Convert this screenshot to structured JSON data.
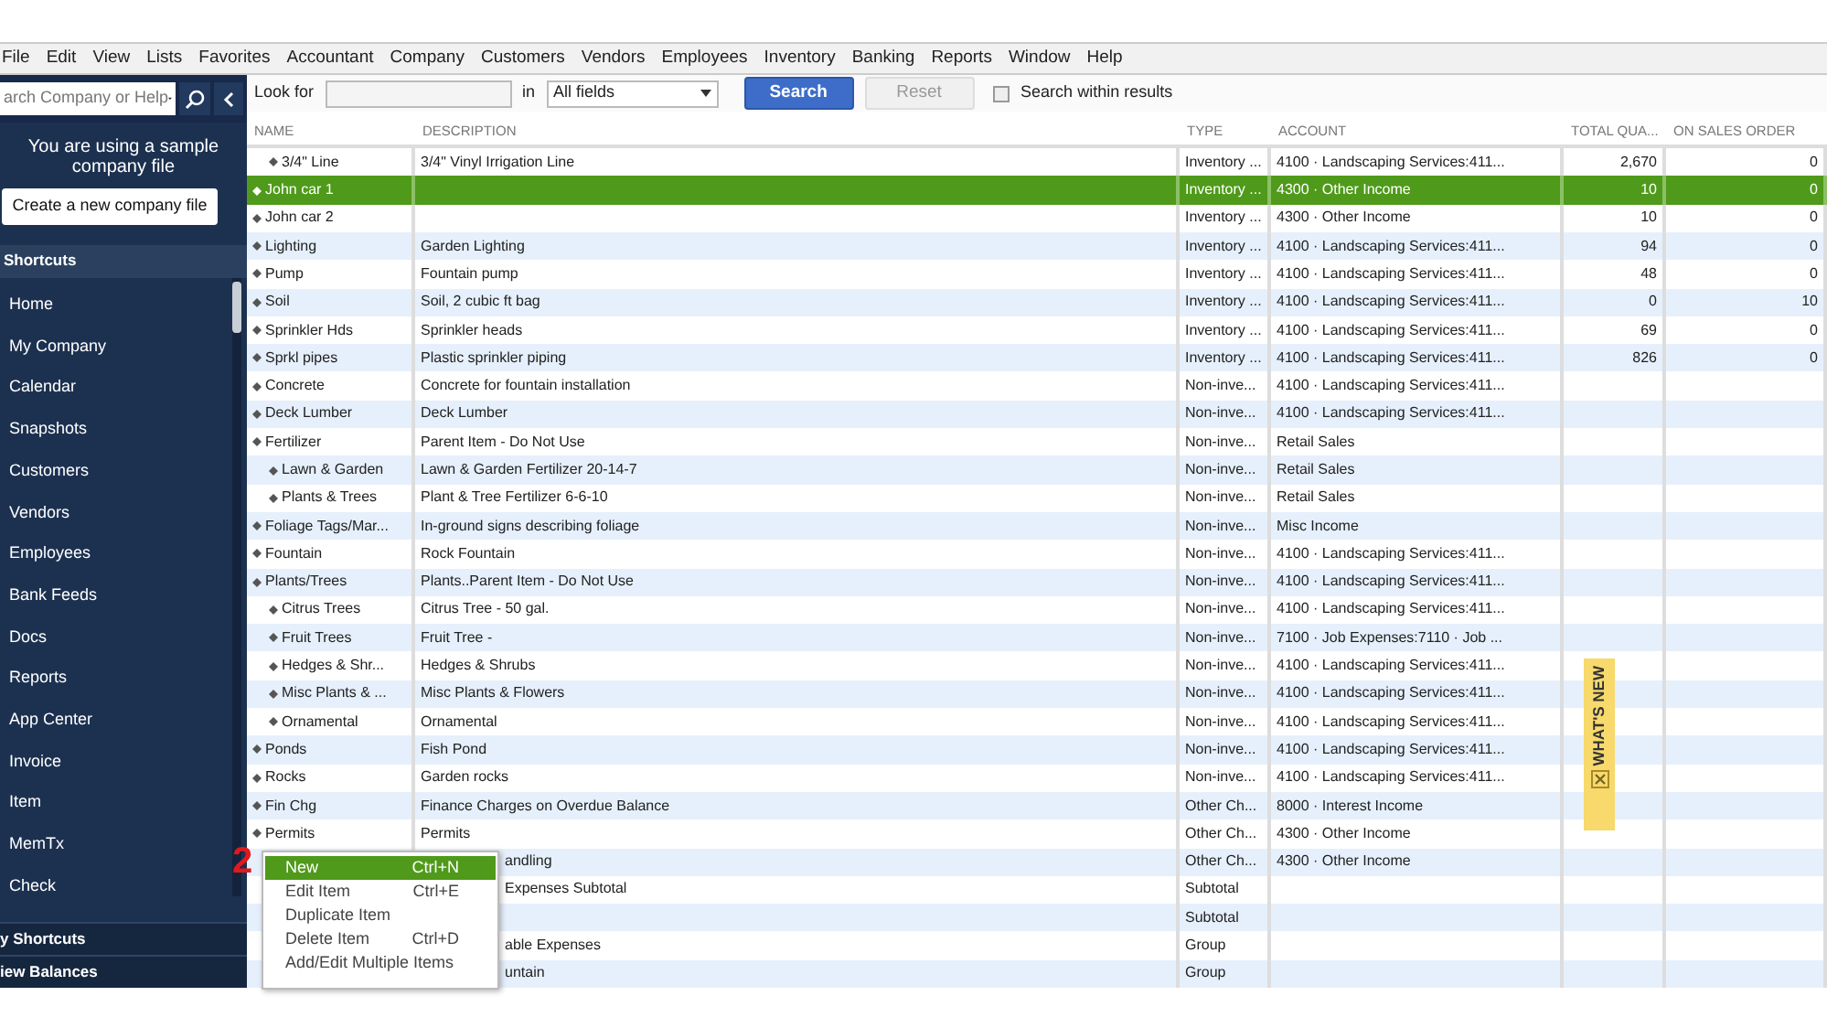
{
  "menu_bar": [
    "File",
    "Edit",
    "View",
    "Lists",
    "Favorites",
    "Accountant",
    "Company",
    "Customers",
    "Vendors",
    "Employees",
    "Inventory",
    "Banking",
    "Reports",
    "Window",
    "Help"
  ],
  "sidebar": {
    "search": {
      "placeholder": "arch Company or Help"
    },
    "sample_notice": "You are using a sample company file",
    "create_button": "Create a new company file",
    "header": "Shortcuts",
    "items": [
      "Home",
      "My Company",
      "Calendar",
      "Snapshots",
      "Customers",
      "Vendors",
      "Employees",
      "Bank Feeds",
      "Docs",
      "Reports",
      "App Center",
      "Invoice",
      "Item",
      "MemTx",
      "Check"
    ],
    "footer": [
      "y Shortcuts",
      "iew Balances"
    ]
  },
  "search_bar": {
    "look_for_label": "Look for",
    "in_label": "in",
    "field_select": "All fields",
    "search_button": "Search",
    "reset_button": "Reset",
    "reset_disabled": true,
    "within_results": {
      "label": "Search within results",
      "checked": false
    }
  },
  "table": {
    "columns": [
      "NAME",
      "DESCRIPTION",
      "TYPE",
      "ACCOUNT",
      "TOTAL QUA...",
      "ON SALES ORDER"
    ],
    "rows": [
      {
        "children": [
          {
            "name": "3/4\" Line",
            "description": "3/4\"  Vinyl Irrigation Line",
            "type": "Inventory ...",
            "account": "4100 · Landscaping Services:411...",
            "total_qty": "2,670",
            "on_sales_order": "0",
            "selected": false
          }
        ]
      },
      {
        "name": "John car 1",
        "type": "Inventory ...",
        "account": "4300 · Other Income",
        "total_qty": "10",
        "on_sales_order": "0",
        "selected": true
      },
      {
        "name": "John car 2",
        "type": "Inventory ...",
        "account": "4300 · Other Income",
        "total_qty": "10",
        "on_sales_order": "0",
        "selected": false
      },
      {
        "name": "Lighting",
        "description": "Garden Lighting",
        "type": "Inventory ...",
        "account": "4100 · Landscaping Services:411...",
        "total_qty": "94",
        "on_sales_order": "0",
        "selected": false
      },
      {
        "name": "Pump",
        "description": "Fountain pump",
        "type": "Inventory ...",
        "account": "4100 · Landscaping Services:411...",
        "total_qty": "48",
        "on_sales_order": "0",
        "selected": false
      },
      {
        "name": "Soil",
        "description": "Soil, 2 cubic ft bag",
        "type": "Inventory ...",
        "account": "4100 · Landscaping Services:411...",
        "total_qty": "0",
        "on_sales_order": "10",
        "selected": false
      },
      {
        "name": "Sprinkler Hds",
        "description": "Sprinkler heads",
        "type": "Inventory ...",
        "account": "4100 · Landscaping Services:411...",
        "total_qty": "69",
        "on_sales_order": "0",
        "selected": false
      },
      {
        "name": "Sprkl pipes",
        "description": "Plastic sprinkler piping",
        "type": "Inventory ...",
        "account": "4100 · Landscaping Services:411...",
        "total_qty": "826",
        "on_sales_order": "0",
        "selected": false
      },
      {
        "name": "Concrete",
        "description": "Concrete for fountain installation",
        "type": "Non-inve...",
        "account": "4100 · Landscaping Services:411...",
        "selected": false
      },
      {
        "name": "Deck Lumber",
        "description": "Deck Lumber",
        "type": "Non-inve...",
        "account": "4100 · Landscaping Services:411...",
        "selected": false
      },
      {
        "name": "Fertilizer",
        "description": "Parent Item - Do Not Use",
        "type": "Non-inve...",
        "account": "Retail Sales",
        "selected": false,
        "children": [
          {
            "name": "Lawn & Garden",
            "description": "Lawn & Garden Fertilizer 20-14-7",
            "type": "Non-inve...",
            "account": "Retail Sales",
            "selected": false
          },
          {
            "name": "Plants & Trees",
            "description": "Plant & Tree Fertilizer 6-6-10",
            "type": "Non-inve...",
            "account": "Retail Sales",
            "selected": false
          }
        ]
      },
      {
        "name": "Foliage Tags/Mar...",
        "description": "In-ground signs describing foliage",
        "type": "Non-inve...",
        "account": "Misc Income",
        "selected": false
      },
      {
        "name": "Fountain",
        "description": "Rock Fountain",
        "type": "Non-inve...",
        "account": "4100 · Landscaping Services:411...",
        "selected": false
      },
      {
        "name": "Plants/Trees",
        "description": "Plants..Parent Item - Do Not Use",
        "type": "Non-inve...",
        "account": "4100 · Landscaping Services:411...",
        "selected": false,
        "children": [
          {
            "name": "Citrus Trees",
            "description": "Citrus Tree - 50 gal.",
            "type": "Non-inve...",
            "account": "4100 · Landscaping Services:411...",
            "selected": false
          },
          {
            "name": "Fruit Trees",
            "description": "Fruit Tree -",
            "type": "Non-inve...",
            "account": "7100 · Job Expenses:7110 · Job ...",
            "selected": false
          },
          {
            "name": "Hedges & Shr...",
            "description": "Hedges & Shrubs",
            "type": "Non-inve...",
            "account": "4100 · Landscaping Services:411...",
            "selected": false
          },
          {
            "name": "Misc Plants & ...",
            "description": "Misc Plants & Flowers",
            "type": "Non-inve...",
            "account": "4100 · Landscaping Services:411...",
            "selected": false
          },
          {
            "name": "Ornamental",
            "description": "Ornamental",
            "type": "Non-inve...",
            "account": "4100 · Landscaping Services:411...",
            "selected": false
          }
        ]
      },
      {
        "name": "Ponds",
        "description": "Fish Pond",
        "type": "Non-inve...",
        "account": "4100 · Landscaping Services:411...",
        "selected": false
      },
      {
        "name": "Rocks",
        "description": "Garden rocks",
        "type": "Non-inve...",
        "account": "4100 · Landscaping Services:411...",
        "selected": false
      },
      {
        "name": "Fin Chg",
        "description": "Finance Charges on Overdue Balance",
        "type": "Other Ch...",
        "account": "8000 · Interest Income",
        "selected": false
      },
      {
        "name": "Permits",
        "description": "Permits",
        "type": "Other Ch...",
        "account": "4300 · Other Income",
        "selected": false
      },
      {
        "covered": true,
        "description": "andling",
        "type": "Other Ch...",
        "account": "4300 · Other Income",
        "selected": false
      },
      {
        "covered": true,
        "description": "Expenses Subtotal",
        "type": "Subtotal",
        "selected": false
      },
      {
        "type": "Subtotal",
        "selected": false
      },
      {
        "covered": true,
        "description": "able Expenses",
        "type": "Group",
        "selected": false
      },
      {
        "covered": true,
        "description": "untain",
        "type": "Group",
        "selected": false
      }
    ]
  },
  "context_menu": [
    {
      "label": "New",
      "shortcut": "Ctrl+N",
      "selected": true
    },
    {
      "label": "Edit Item",
      "shortcut": "Ctrl+E",
      "selected": false
    },
    {
      "label": "Duplicate Item",
      "selected": false
    },
    {
      "label": "Delete Item",
      "shortcut": "Ctrl+D",
      "selected": false
    },
    {
      "label": "Add/Edit Multiple Items",
      "selected": false
    }
  ],
  "annotation": "2",
  "whats_new": "WHAT'S NEW"
}
